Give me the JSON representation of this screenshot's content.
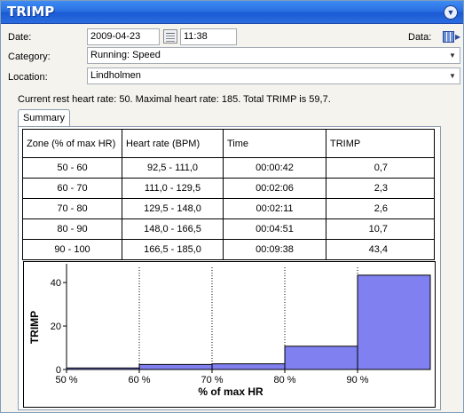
{
  "window": {
    "title": "TRIMP"
  },
  "form": {
    "date_label": "Date:",
    "date_value": "2009-04-23",
    "time_value": "11:38",
    "data_label": "Data:",
    "category_label": "Category:",
    "category_value": "Running: Speed",
    "location_label": "Location:",
    "location_value": "Lindholmen"
  },
  "info_text": "Current rest heart rate: 50. Maximal heart rate: 185. Total TRIMP is 59,7.",
  "tab_label": "Summary",
  "table": {
    "headers": [
      "Zone (% of max HR)",
      "Heart rate (BPM)",
      "Time",
      "TRIMP"
    ],
    "rows": [
      [
        "50 - 60",
        "92,5 - 111,0",
        "00:00:42",
        "0,7"
      ],
      [
        "60 - 70",
        "111,0 - 129,5",
        "00:02:06",
        "2,3"
      ],
      [
        "70 - 80",
        "129,5 - 148,0",
        "00:02:11",
        "2,6"
      ],
      [
        "80 - 90",
        "148,0 - 166,5",
        "00:04:51",
        "10,7"
      ],
      [
        "90 - 100",
        "166,5 - 185,0",
        "00:09:38",
        "43,4"
      ]
    ]
  },
  "chart_data": {
    "type": "bar",
    "categories": [
      "50-60",
      "60-70",
      "70-80",
      "80-90",
      "90-100"
    ],
    "x_edges": [
      50,
      60,
      70,
      80,
      90,
      100
    ],
    "values": [
      0.7,
      2.3,
      2.6,
      10.7,
      43.4
    ],
    "xlabel": "% of max HR",
    "ylabel": "TRIMP",
    "xticks": [
      "50 %",
      "60 %",
      "70 %",
      "80 %",
      "90 %"
    ],
    "yticks": [
      "0",
      "20",
      "40"
    ],
    "ylim": [
      0,
      47
    ],
    "xlim": [
      50,
      100
    ],
    "grid": true,
    "bar_color": "#8080f0"
  }
}
